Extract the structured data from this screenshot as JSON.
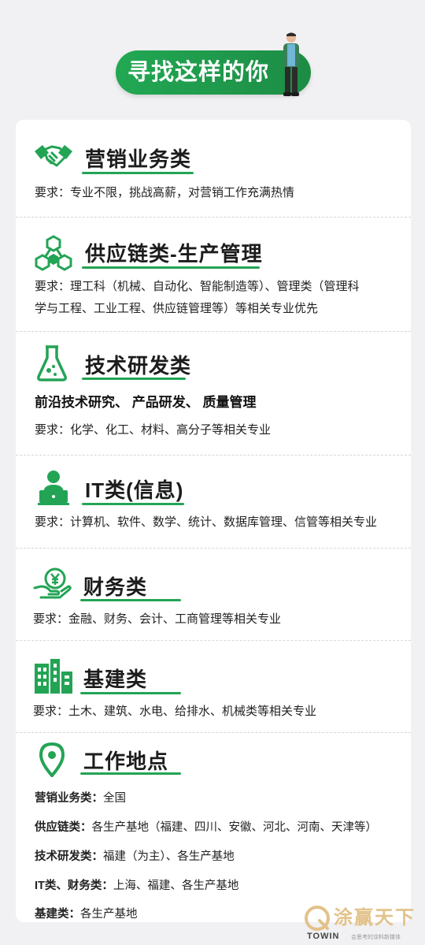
{
  "header": {
    "title": "寻找这样的你"
  },
  "sections": [
    {
      "title": "营销业务类",
      "icon": "handshake-icon",
      "req": "要求：专业不限，挑战高薪，对营销工作充满热情"
    },
    {
      "title": "供应链类-生产管理",
      "icon": "hexagon-network-icon",
      "req_line1": "要求：理工科（机械、自动化、智能制造等）、管理类（管理科",
      "req_line2": "学与工程、工业工程、供应链管理等）等相关专业优先"
    },
    {
      "title": "技术研发类",
      "icon": "flask-icon",
      "focus": "前沿技术研究、 产品研发、 质量管理",
      "req": "要求：化学、化工、材料、高分子等相关专业"
    },
    {
      "title": "IT类(信息)",
      "icon": "computer-user-icon",
      "req": "要求：计算机、软件、数学、统计、数据库管理、信管等相关专业"
    },
    {
      "title": "财务类",
      "icon": "yuan-hand-icon",
      "req": "要求：金融、财务、会计、工商管理等相关专业"
    },
    {
      "title": "基建类",
      "icon": "buildings-icon",
      "req": "要求：土木、建筑、水电、给排水、机械类等相关专业"
    },
    {
      "title": "工作地点",
      "icon": "location-pin-icon"
    }
  ],
  "locations": [
    {
      "label": "营销业务类：",
      "value": "全国"
    },
    {
      "label": "供应链类：",
      "value": "各生产基地（福建、四川、安徽、河北、河南、天津等）"
    },
    {
      "label": "技术研发类：",
      "value": "福建（为主）、各生产基地"
    },
    {
      "label": "IT类、财务类：",
      "value": "上海、福建、各生产基地"
    },
    {
      "label": "基建类：",
      "value": "各生产基地"
    }
  ],
  "logo": {
    "name": "涂赢天下",
    "brand": "TOWIN",
    "tagline": "会思考的涂料新媒体"
  },
  "colors": {
    "accent": "#23a455",
    "gold": "#e2c28a",
    "background": "#f1f1f3"
  }
}
